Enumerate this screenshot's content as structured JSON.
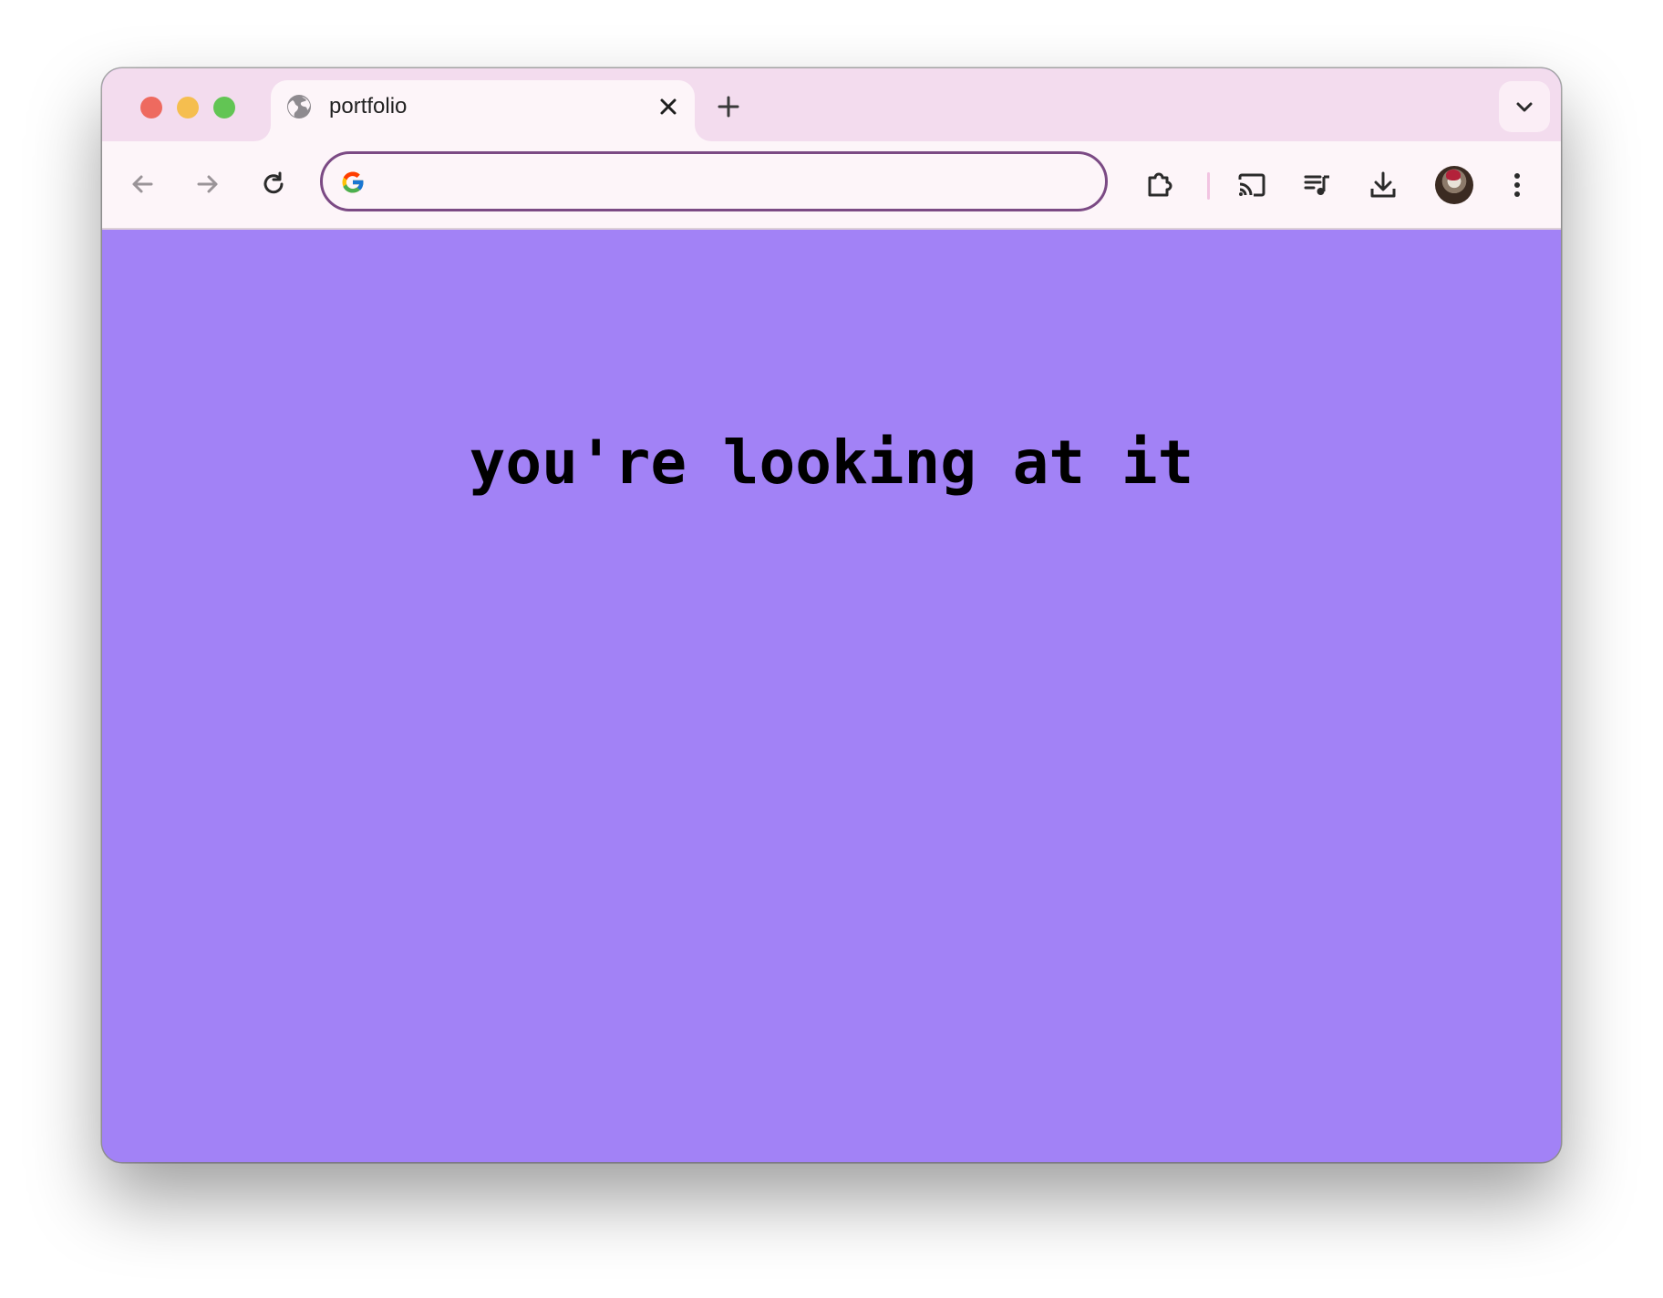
{
  "window": {
    "controls": [
      "close",
      "minimize",
      "maximize"
    ]
  },
  "tabs": [
    {
      "title": "portfolio",
      "favicon": "globe-icon",
      "active": true
    }
  ],
  "toolbar": {
    "back_icon": "arrow-left-icon",
    "forward_icon": "arrow-right-icon",
    "reload_icon": "reload-icon",
    "omnibox": {
      "value": "",
      "placeholder": "",
      "provider_icon": "google-g-icon"
    },
    "right_icons": [
      "extensions-icon",
      "cast-icon",
      "media-queue-icon",
      "download-icon",
      "profile-avatar",
      "more-menu-icon"
    ]
  },
  "page": {
    "headline": "you're looking at it",
    "background_color": "#a282f6"
  },
  "colors": {
    "tab_strip": "#f3dcee",
    "toolbar": "#fdf5f9",
    "omnibox_border": "#7b4a84"
  }
}
